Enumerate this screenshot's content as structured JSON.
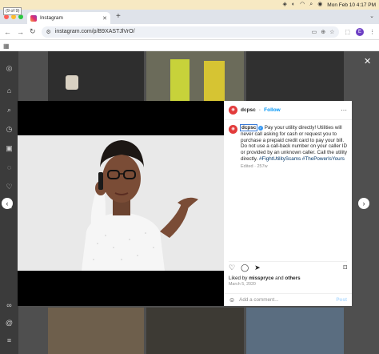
{
  "screenshot_counter": "(9 of 9)",
  "menubar": {
    "clock": "Mon Feb 10  4:17 PM"
  },
  "browser": {
    "tab_title": "Instagram",
    "url": "instagram.com/p/B9XASTJlVrO/",
    "profile_initial": "E"
  },
  "post": {
    "account": "dcpsc",
    "follow_label": "Follow",
    "caption_handle": "dcpsc",
    "caption_text": " Pay your utility directly! Utilities will never call asking for cash or request you to purchase a prepaid credit card to pay your bill. Do not use a call-back number on your caller ID or provided by an unknown caller. Call the utility directly. ",
    "hashtag_1": "#FightUtilityScams",
    "hashtag_2": "#ThePowerIsYours",
    "edited": "Edited · 257w",
    "liked_by_prefix": "Liked by ",
    "liked_by_user": "misspryce",
    "liked_by_and": " and ",
    "liked_by_others": "others",
    "date": "March 5, 2020",
    "comment_placeholder": "Add a comment...",
    "post_label": "Post"
  },
  "colors": {
    "accent": "#0095f6",
    "avatar": "#e23b3b",
    "backdrop": "#4f4f4f"
  },
  "icons": [
    "apple-icon",
    "wifi-icon",
    "search-icon",
    "close-icon",
    "back-icon",
    "forward-icon",
    "reload-icon",
    "heart-icon",
    "comment-icon",
    "share-icon",
    "bookmark-icon",
    "emoji-icon",
    "chevron-left-icon",
    "chevron-right-icon"
  ]
}
